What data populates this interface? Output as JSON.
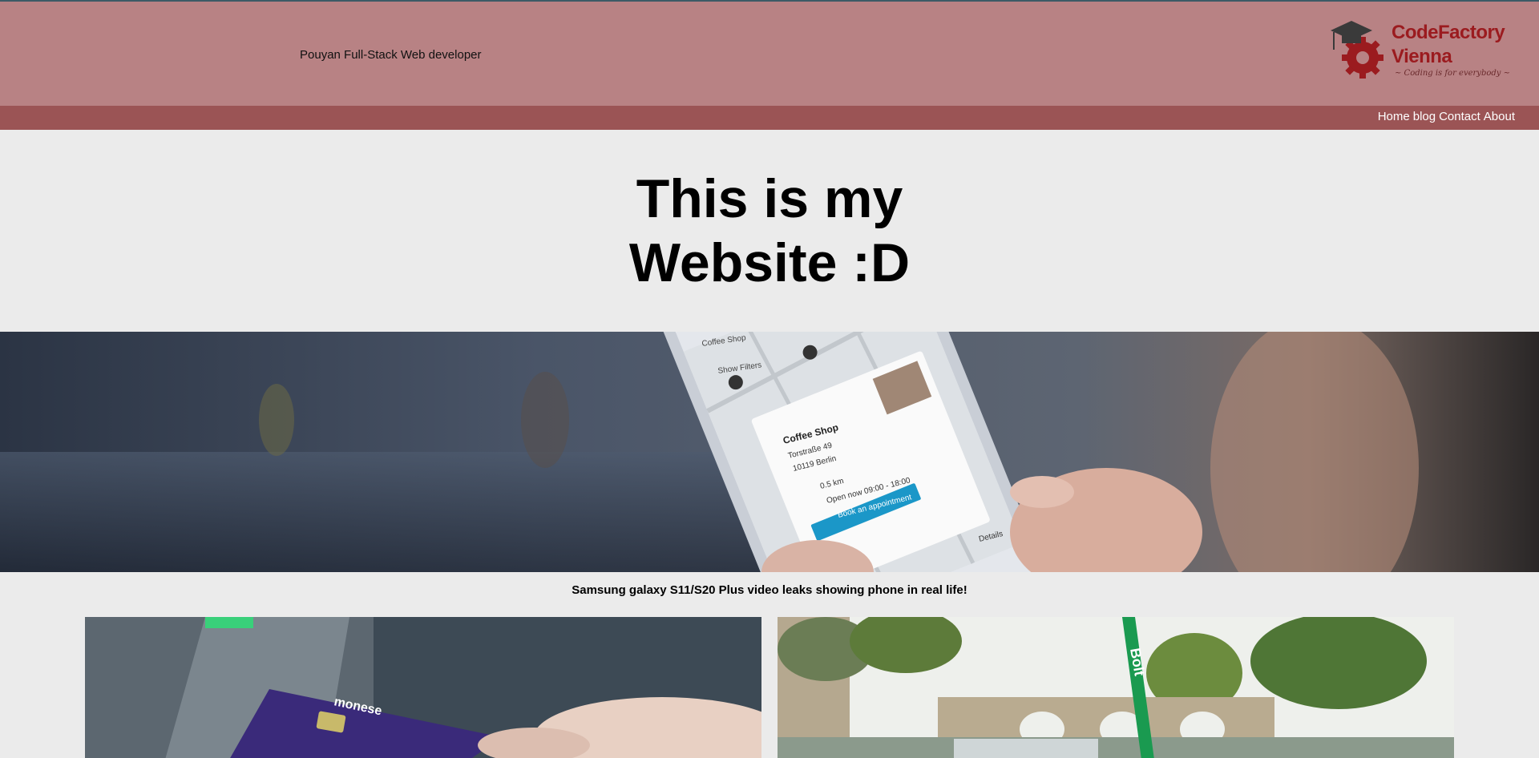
{
  "header": {
    "tagline": "Pouyan Full-Stack Web developer",
    "logo": {
      "name_line1": "CodeFactory",
      "name_line2": "Vienna",
      "slogan": "~ Coding is for everybody ~"
    }
  },
  "nav": {
    "items": [
      "Home",
      "blog",
      "Contact",
      "About"
    ]
  },
  "hero": {
    "title": "This is my Website :D"
  },
  "banner": {
    "caption": "Samsung galaxy S11/S20 Plus video leaks showing phone in real life!",
    "app": {
      "header_label": "Coffee Shop",
      "filter_label": "Show Filters",
      "card_title": "Coffee Shop",
      "address_line1": "Torstraße 49",
      "address_line2": "10119 Berlin",
      "distance": "0.5 km",
      "hours": "Open now 09:00 - 18:00",
      "book_button": "Book an appointment",
      "details_label": "Details"
    }
  },
  "cards": {
    "left_card_brand": "monese",
    "right_card_brand": "Bolt"
  },
  "colors": {
    "header_bg": "#b88284",
    "nav_bg": "#9b5455",
    "page_bg": "#ebebeb",
    "logo_red": "#9b1b1f"
  }
}
